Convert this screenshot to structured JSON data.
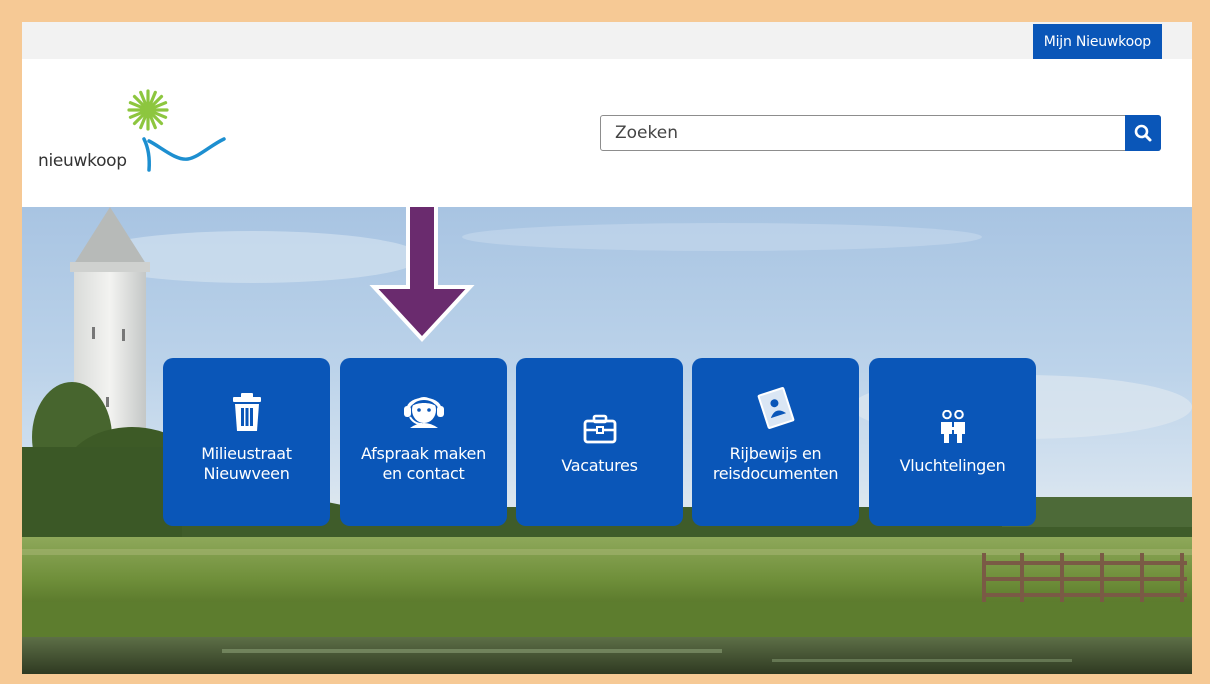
{
  "topbar": {
    "account_label": "Mijn Nieuwkoop"
  },
  "header": {
    "logo_text": "nieuwkoop"
  },
  "search": {
    "placeholder": "Zoeken"
  },
  "tiles": [
    {
      "label_line1": "Milieustraat",
      "label_line2": "Nieuwveen",
      "icon": "trash-icon"
    },
    {
      "label_line1": "Afspraak maken",
      "label_line2": "en contact",
      "icon": "headset-icon"
    },
    {
      "label": "Vacatures",
      "icon": "briefcase-icon"
    },
    {
      "label_line1": "Rijbewijs en",
      "label_line2": "reisdocumenten",
      "icon": "id-document-icon"
    },
    {
      "label": "Vluchtelingen",
      "icon": "people-icon"
    }
  ],
  "colors": {
    "brand_blue": "#0a56b8",
    "frame_orange": "#f6c995",
    "annotation_arrow": "#6a2b6e",
    "logo_green": "#8dc63f",
    "logo_wave": "#1d8fd0"
  }
}
